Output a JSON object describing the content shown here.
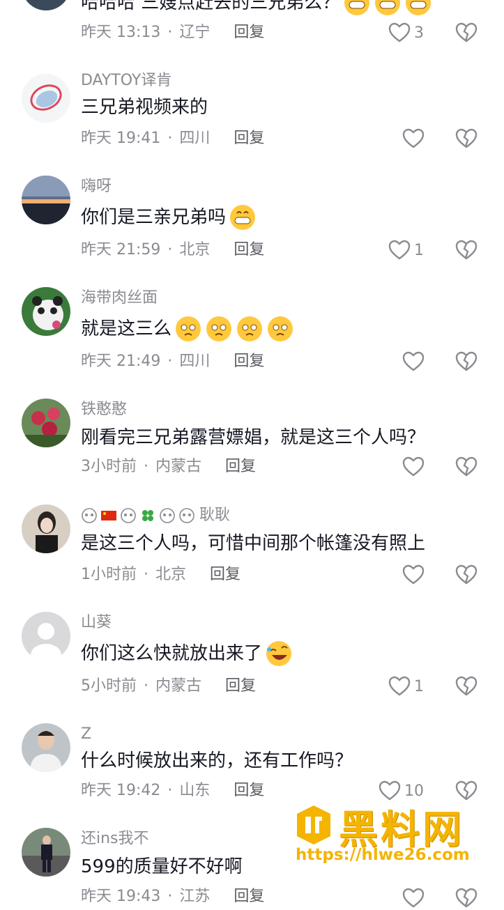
{
  "comments": [
    {
      "username": "",
      "text": "哈哈哈 三嫂点赶去的三兄弟么？",
      "time": "昨天 13:13",
      "location": "辽宁",
      "reply": "回复",
      "likes": "3"
    },
    {
      "username": "DAYTOY译肯",
      "text": "三兄弟视频来的",
      "time": "昨天 19:41",
      "location": "四川",
      "reply": "回复",
      "likes": ""
    },
    {
      "username": "嗨呀",
      "text": "你们是三亲兄弟吗",
      "time": "昨天 21:59",
      "location": "北京",
      "reply": "回复",
      "likes": "1"
    },
    {
      "username": "海带肉丝面",
      "text": "就是这三么",
      "time": "昨天 21:49",
      "location": "四川",
      "reply": "回复",
      "likes": ""
    },
    {
      "username": "铁憨憨",
      "text": "刚看完三兄弟露营嫖娼，就是这三个人吗？",
      "time": "3小时前",
      "location": "内蒙古",
      "reply": "回复",
      "likes": ""
    },
    {
      "username": "耿耿",
      "text": "是这三个人吗，可惜中间那个帐篷没有照上",
      "time": "1小时前",
      "location": "北京",
      "reply": "回复",
      "likes": ""
    },
    {
      "username": "山葵",
      "text": "你们这么快就放出来了",
      "time": "5小时前",
      "location": "内蒙古",
      "reply": "回复",
      "likes": "1"
    },
    {
      "username": "Z",
      "text": "什么时候放出来的，还有工作吗？",
      "time": "昨天 19:42",
      "location": "山东",
      "reply": "回复",
      "likes": "10"
    },
    {
      "username": "还ins我不",
      "text": "599的质量好不好啊",
      "time": "昨天 19:43",
      "location": "江苏",
      "reply": "回复",
      "likes": ""
    }
  ],
  "meta_separator": "·",
  "icons": {
    "like": "heart-outline-icon",
    "dislike": "broken-heart-icon"
  },
  "watermark": {
    "title": "黑料网",
    "url": "https://hlwe26.com"
  }
}
